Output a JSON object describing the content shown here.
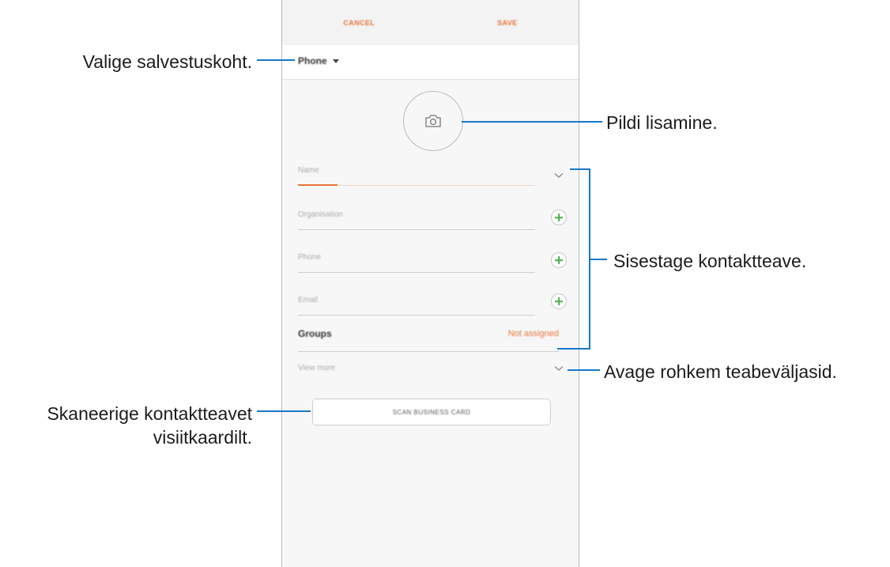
{
  "topbar": {
    "cancel": "CANCEL",
    "save": "SAVE"
  },
  "storage": {
    "label": "Phone"
  },
  "fields": {
    "name": "Name",
    "organisation": "Organisation",
    "phone": "Phone",
    "email": "Email"
  },
  "groups": {
    "label": "Groups",
    "value": "Not assigned"
  },
  "view_more": "View more",
  "scan_button": "SCAN BUSINESS CARD",
  "callouts": {
    "storage": "Valige salvestuskoht.",
    "photo": "Pildi lisamine.",
    "contact_info": "Sisestage kontaktteave.",
    "more_fields": "Avage rohkem teabeväljasid.",
    "scan_line1": "Skaneerige kontaktteavet",
    "scan_line2": "visiitkaardilt."
  },
  "colors": {
    "accent": "#e8753c",
    "callout_line": "#1878c8",
    "plus": "#4caf50"
  },
  "icons": [
    "camera-icon",
    "chevron-down-icon",
    "plus-icon",
    "caret-down-icon"
  ]
}
